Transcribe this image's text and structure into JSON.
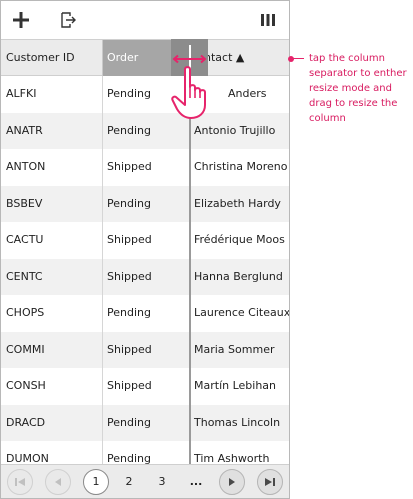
{
  "toolbar": {
    "add_icon": "plus-icon",
    "export_icon": "export-icon",
    "columns_icon": "columns-icon"
  },
  "header": {
    "columns": [
      "Customer ID",
      "Order",
      "ntact ▲"
    ]
  },
  "rows": [
    [
      "ALFKI",
      "Pending",
      "Anders"
    ],
    [
      "ANATR",
      "Pending",
      "Antonio Trujillo"
    ],
    [
      "ANTON",
      "Shipped",
      "Christina Moreno"
    ],
    [
      "BSBEV",
      "Pending",
      "Elizabeth Hardy"
    ],
    [
      "CACTU",
      "Shipped",
      "Frédérique Moos"
    ],
    [
      "CENTC",
      "Shipped",
      "Hanna Berglund"
    ],
    [
      "CHOPS",
      "Pending",
      "Laurence Citeaux"
    ],
    [
      "COMMI",
      "Shipped",
      "Maria Sommer"
    ],
    [
      "CONSH",
      "Shipped",
      "Martín Lebihan"
    ],
    [
      "DRACD",
      "Pending",
      "Thomas Lincoln"
    ],
    [
      "DUMON",
      "Pending",
      "Tim Ashworth"
    ]
  ],
  "pager": {
    "pages": [
      "1",
      "2",
      "3",
      "..."
    ],
    "current_page": "1"
  },
  "annotation": {
    "text": "tap the column separator to enther resize mode and drag to resize the column",
    "color": "#e6246b"
  }
}
